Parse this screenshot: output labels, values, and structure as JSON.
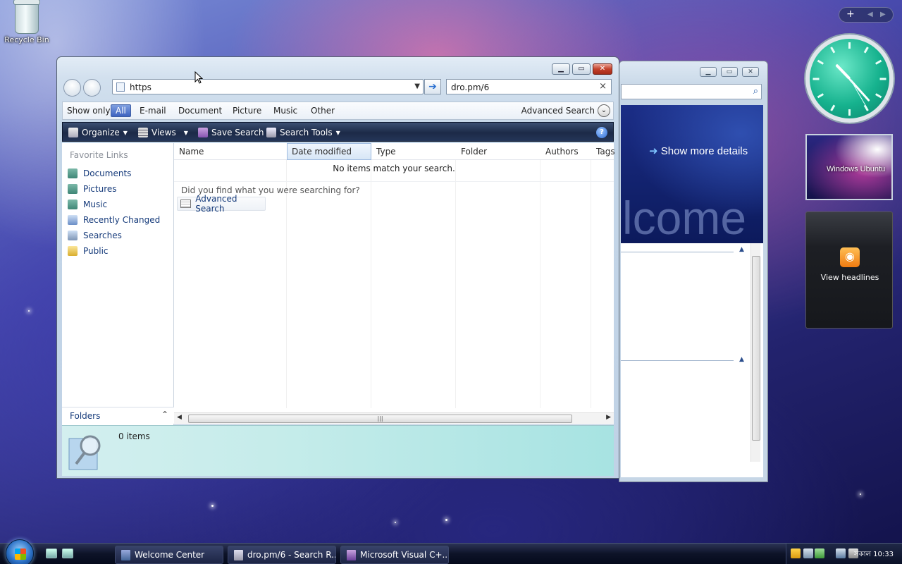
{
  "desktop": {
    "recycle_label": "Recycle Bin"
  },
  "bg_window": {
    "show_more": "Show more details",
    "welcome_text": "lcome"
  },
  "window": {
    "address": {
      "value": "https"
    },
    "search": {
      "value": "dro.pm/6"
    },
    "show_only": {
      "label": "Show only:",
      "filters": [
        "All",
        "E-mail",
        "Document",
        "Picture",
        "Music",
        "Other"
      ],
      "selected": "All",
      "advanced": "Advanced Search"
    },
    "toolbar": {
      "organize": "Organize",
      "views": "Views",
      "save_search": "Save Search",
      "search_tools": "Search Tools"
    },
    "favorites": {
      "header": "Favorite Links",
      "items": [
        "Documents",
        "Pictures",
        "Music",
        "Recently Changed",
        "Searches",
        "Public"
      ]
    },
    "folders_label": "Folders",
    "columns": [
      "Name",
      "Date modified",
      "Type",
      "Folder",
      "Authors",
      "Tags"
    ],
    "no_items": "No items match your search.",
    "did_you_find": "Did you find what you were searching for?",
    "advanced_search_button": "Advanced Search",
    "details": {
      "count": "0 items"
    }
  },
  "gadgets": {
    "slideshow_caption": "Windows Ubuntu",
    "feed_label": "View headlines",
    "clock_time": "10:33"
  },
  "taskbar": {
    "buttons": [
      "Welcome Center",
      "dro.pm/6 - Search R...",
      "Microsoft Visual C+..."
    ],
    "clock": "সকাল 10:33"
  },
  "colors": {
    "accent": "#3e63c0",
    "taskbar": "#0d1328",
    "clock_face": "#16b28e",
    "close_button": "#c3412b"
  }
}
